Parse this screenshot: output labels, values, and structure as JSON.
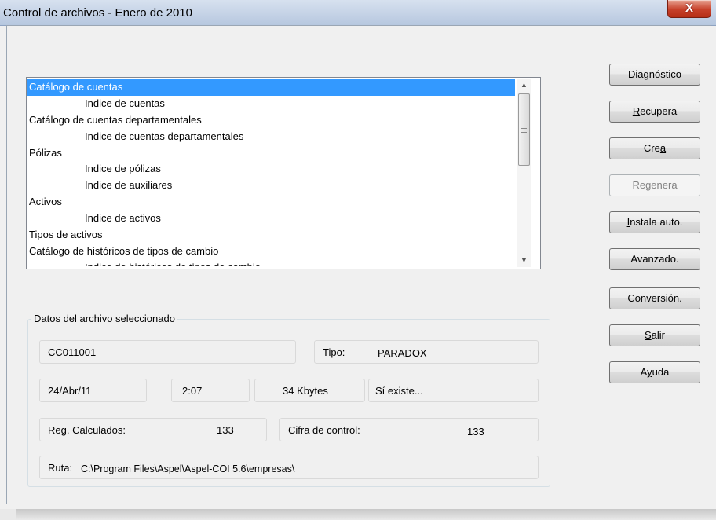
{
  "window": {
    "title": "Control de archivos - Enero de 2010",
    "close_glyph": "X"
  },
  "file_list": {
    "items": [
      {
        "label": "Catálogo de cuentas",
        "level": 0,
        "selected": true
      },
      {
        "label": "Indice de cuentas",
        "level": 1
      },
      {
        "label": "Catálogo de cuentas departamentales",
        "level": 0
      },
      {
        "label": "Indice de cuentas departamentales",
        "level": 1
      },
      {
        "label": "Pólizas",
        "level": 0
      },
      {
        "label": "Indice de pólizas",
        "level": 1
      },
      {
        "label": "Indice de auxiliares",
        "level": 1
      },
      {
        "label": "Activos",
        "level": 0
      },
      {
        "label": "Indice de activos",
        "level": 1
      },
      {
        "label": "Tipos de activos",
        "level": 0
      },
      {
        "label": "Catálogo de históricos de tipos de cambio",
        "level": 0
      },
      {
        "label": "Indice de históricos de tipos de cambio",
        "level": 1
      }
    ]
  },
  "details": {
    "group_label": "Datos del archivo seleccionado",
    "file_code": "CC011001",
    "type_label": "Tipo:",
    "type_value": "PARADOX",
    "date": "24/Abr/11",
    "time": "2:07",
    "size": "34 Kbytes",
    "exists": "Sí existe...",
    "reg_calc_label": "Reg. Calculados:",
    "reg_calc_value": "133",
    "control_label": "Cifra de control:",
    "control_value": "133",
    "path_label": "Ruta:",
    "path_value": "C:\\Program Files\\Aspel\\Aspel-COI 5.6\\empresas\\"
  },
  "buttons": {
    "diagnostico": {
      "pre": "",
      "key": "D",
      "post": "iagnóstico"
    },
    "recupera": {
      "pre": "",
      "key": "R",
      "post": "ecupera"
    },
    "crea": {
      "pre": "Cre",
      "key": "a",
      "post": ""
    },
    "regenera": {
      "pre": "Re",
      "key": "g",
      "post": "enera"
    },
    "instala": {
      "pre": "",
      "key": "I",
      "post": "nstala auto."
    },
    "avanzado": {
      "label": "Avanzado."
    },
    "conversion": {
      "label": "Conversión."
    },
    "salir": {
      "pre": "",
      "key": "S",
      "post": "alir"
    },
    "ayuda": {
      "pre": "A",
      "key": "y",
      "post": "uda"
    }
  }
}
